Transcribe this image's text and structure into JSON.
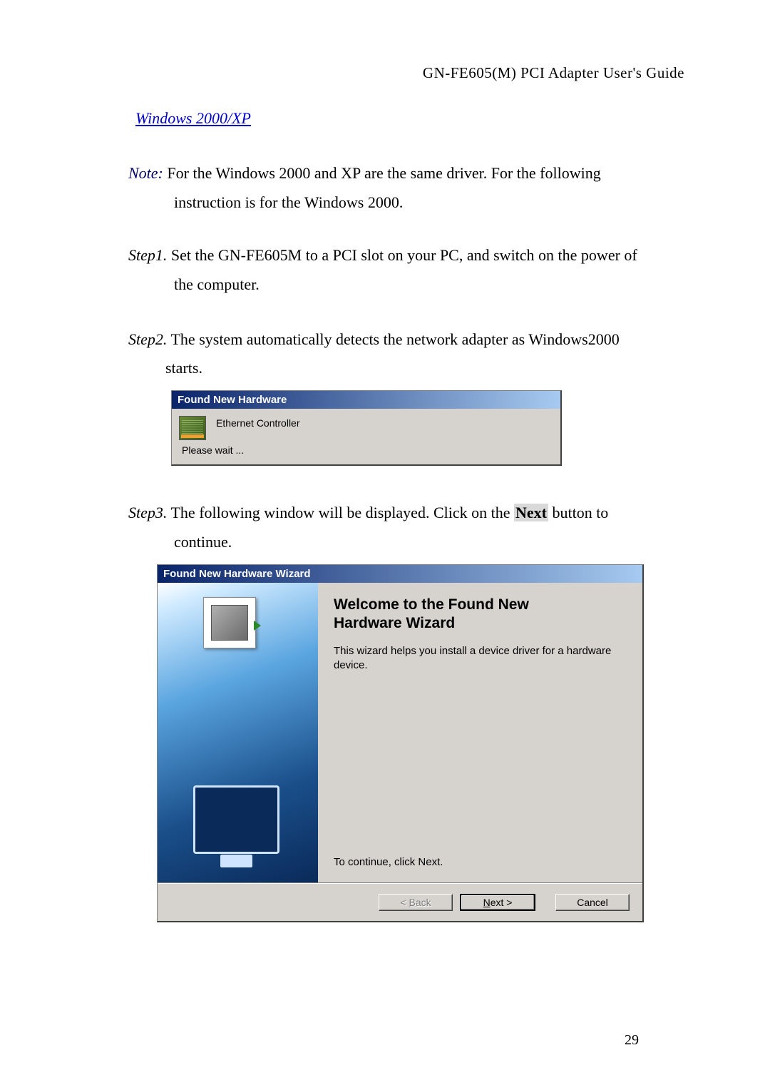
{
  "header": "GN-FE605(M) PCI Adapter User's Guide",
  "section_link": "Windows 2000/XP",
  "note": {
    "label": "Note:",
    "text_line1": " For the Windows 2000 and XP are the same driver. For the following",
    "text_line2": "instruction is for the Windows 2000."
  },
  "step1": {
    "label": "Step1.",
    "line1": " Set the GN-FE605M to a PCI slot on your PC, and switch on the power of",
    "line2": "the computer."
  },
  "step2": {
    "label": "Step2.",
    "line1": " The system automatically detects the network adapter as Windows2000",
    "line2": "starts."
  },
  "dlg1": {
    "title": "Found New Hardware",
    "device": "Ethernet Controller",
    "status": "Please wait ..."
  },
  "step3": {
    "label": "Step3.",
    "line1_a": " The following window will be displayed. Click on the ",
    "bold_word": "Next",
    "line1_b": " button to",
    "line2": "continue."
  },
  "wizard": {
    "title": "Found New Hardware Wizard",
    "heading_l1": "Welcome to the Found New",
    "heading_l2": "Hardware Wizard",
    "desc": "This wizard helps you install a device driver for a hardware device.",
    "continue": "To continue, click Next.",
    "buttons": {
      "back_pre": "< ",
      "back_u": "B",
      "back_post": "ack",
      "next_u": "N",
      "next_post": "ext >",
      "cancel": "Cancel"
    }
  },
  "page_number": "29"
}
